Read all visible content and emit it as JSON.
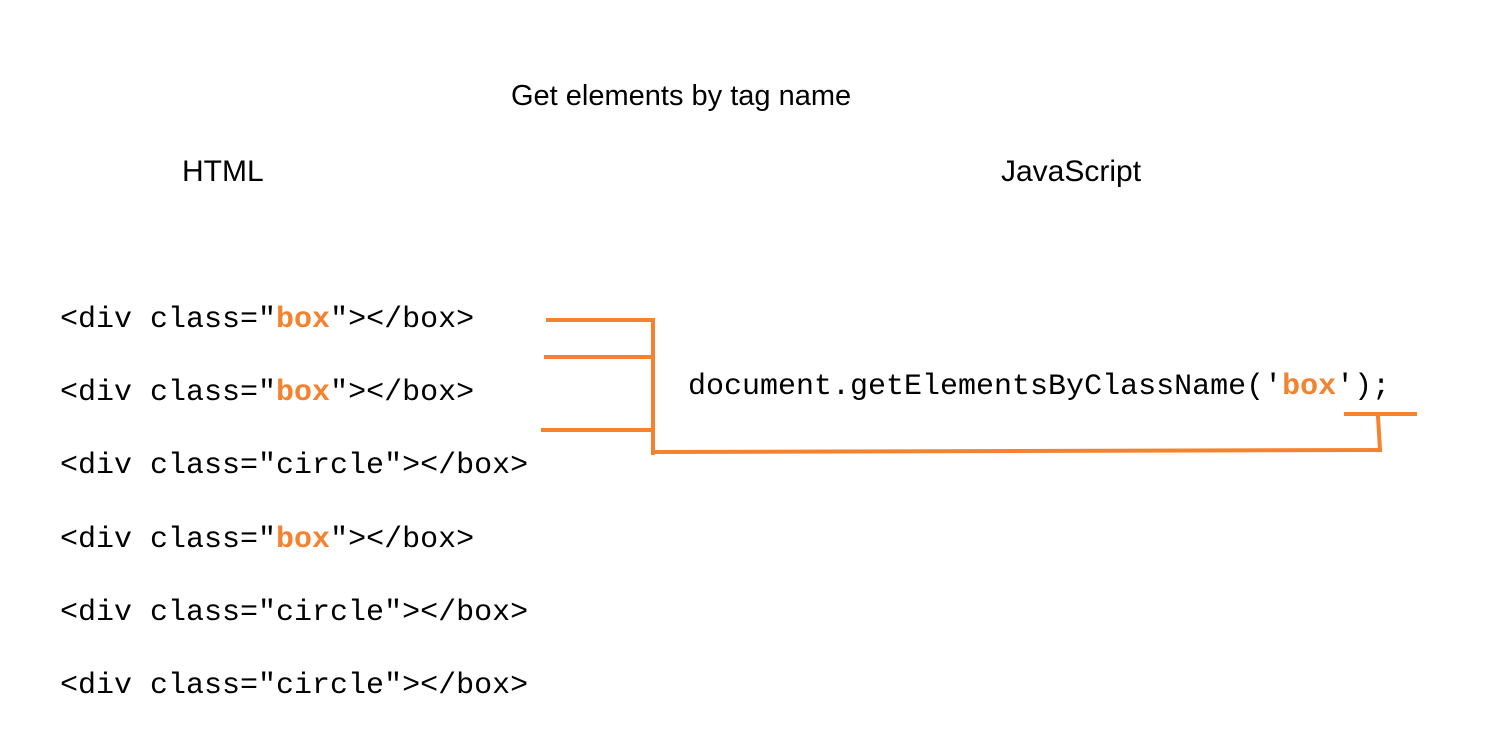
{
  "title": "Get elements by tag name",
  "headings": {
    "html": "HTML",
    "javascript": "JavaScript"
  },
  "html_lines": [
    {
      "before": "<div class=\"",
      "cls": "box",
      "after": "\"></box>",
      "highlight": true
    },
    {
      "before": "<div class=\"",
      "cls": "box",
      "after": "\"></box>",
      "highlight": true
    },
    {
      "before": "<div class=\"",
      "cls": "circle",
      "after": "\"></box>",
      "highlight": false
    },
    {
      "before": "<div class=\"",
      "cls": "box",
      "after": "\"></box>",
      "highlight": true
    },
    {
      "before": "<div class=\"",
      "cls": "circle",
      "after": "\"></box>",
      "highlight": false
    },
    {
      "before": "<div class=\"",
      "cls": "circle",
      "after": "\"></box>",
      "highlight": false
    }
  ],
  "js_code": {
    "before": "document.getElementsByClassName('",
    "arg": "box",
    "after": "');"
  },
  "colors": {
    "accent": "#F5822E",
    "text": "#000000",
    "background": "#FFFFFF"
  }
}
